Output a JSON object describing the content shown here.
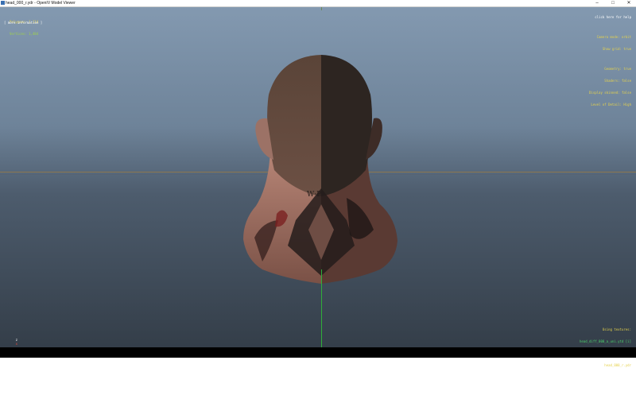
{
  "window": {
    "title": "head_000_r.ydr - OpenIV Model Viewer",
    "minimize_glyph": "–",
    "maximize_glyph": "□",
    "close_glyph": "✕"
  },
  "hud": {
    "top_left_lines": [
      "Polygons: 1,114",
      "Vertices: 1,484"
    ],
    "more_information": "[ more information ]",
    "top_center": "",
    "top_right_lines": [
      "click here for help",
      "",
      "Camera mode: orbit",
      "Show grid: true",
      "",
      "Geometry: true",
      "Shaders: false",
      "Display skinned: false",
      "Level of Detail: High"
    ],
    "bottom_right_title": "Using textures:",
    "bottom_right_lines": [
      "head_diff_000_a_uni.ytd [i]",
      "[+] Add texture",
      "head_000_r.ydr",
      "[ view embedded textures ]",
      "[ export embedded textures ]"
    ],
    "gizmo_labels": [
      "z",
      "x"
    ]
  },
  "colors": {
    "hud_yellow": "#e5d24c",
    "hud_green": "#4bd06b",
    "hud_white": "#ffffff",
    "axis_green": "#2fae3a",
    "background_top": "#8399b0",
    "background_bottom": "#343e49"
  },
  "icons": {
    "app": "openiv-app-icon",
    "model": "head-model"
  }
}
